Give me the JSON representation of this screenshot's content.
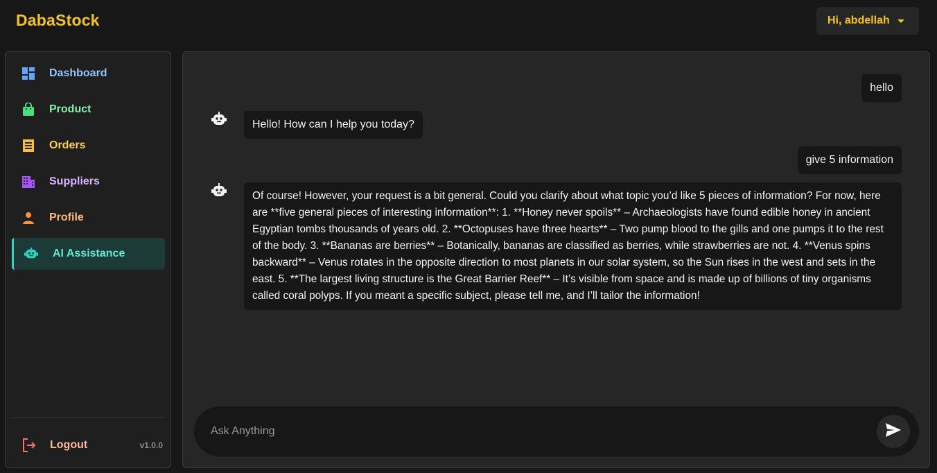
{
  "app": {
    "brand": "DabaStock"
  },
  "header": {
    "greeting": "Hi, abdellah"
  },
  "sidebar": {
    "items": [
      {
        "label": "Dashboard",
        "icon": "dashboard-icon",
        "color": "#93c5fd"
      },
      {
        "label": "Product",
        "icon": "shopping-bag-icon",
        "color": "#86efac"
      },
      {
        "label": "Orders",
        "icon": "receipt-icon",
        "color": "#fcd34d"
      },
      {
        "label": "Suppliers",
        "icon": "building-icon",
        "color": "#d8b4fe"
      },
      {
        "label": "Profile",
        "icon": "person-icon",
        "color": "#fdba74"
      },
      {
        "label": "AI Assistance",
        "icon": "robot-icon",
        "color": "#5eead4",
        "active": true
      }
    ],
    "logout_label": "Logout",
    "version": "v1.0.0"
  },
  "chat": {
    "messages": [
      {
        "role": "user",
        "text": "hello"
      },
      {
        "role": "assistant",
        "text": "Hello! How can I help you today?"
      },
      {
        "role": "user",
        "text": "give 5 information"
      },
      {
        "role": "assistant",
        "text": "Of course! However, your request is a bit general. Could you clarify about what topic you’d like 5 pieces of information? For now, here are **five general pieces of interesting information**: 1. **Honey never spoils** – Archaeologists have found edible honey in ancient Egyptian tombs thousands of years old. 2. **Octopuses have three hearts** – Two pump blood to the gills and one pumps it to the rest of the body. 3. **Bananas are berries** – Botanically, bananas are classified as berries, while strawberries are not. 4. **Venus spins backward** – Venus rotates in the opposite direction to most planets in our solar system, so the Sun rises in the west and sets in the east. 5. **The largest living structure is the Great Barrier Reef** – It’s visible from space and is made up of billions of tiny organisms called coral polyps. If you meant a specific subject, please tell me, and I’ll tailor the information!"
      }
    ],
    "input_placeholder": "Ask Anything",
    "input_value": ""
  },
  "colors": {
    "accent": "#f5c518",
    "active_bg": "#1c3a36",
    "active_border": "#2dd4bf",
    "logout": "#f87171"
  }
}
